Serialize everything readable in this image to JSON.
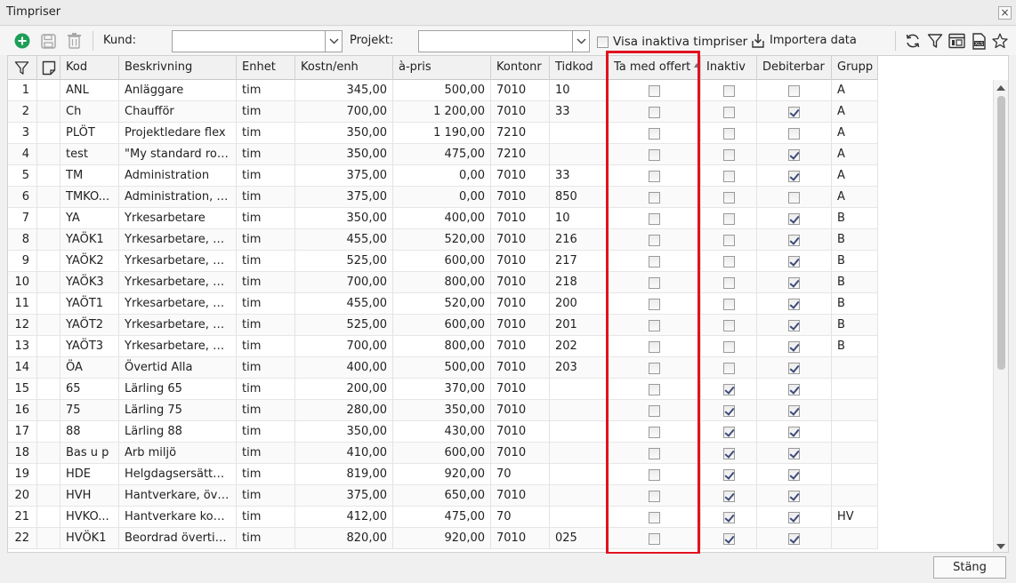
{
  "window": {
    "title": "Timpriser"
  },
  "toolbar": {
    "kund_label": "Kund:",
    "kund_value": "",
    "projekt_label": "Projekt:",
    "projekt_value": "",
    "show_inactive_label": "Visa inaktiva timpriser",
    "show_inactive_checked": false,
    "import_label": "Importera data"
  },
  "columns": [
    {
      "key": "filter",
      "label": ""
    },
    {
      "key": "note",
      "label": ""
    },
    {
      "key": "kod",
      "label": "Kod"
    },
    {
      "key": "beskrivning",
      "label": "Beskrivning"
    },
    {
      "key": "enhet",
      "label": "Enhet"
    },
    {
      "key": "kostn",
      "label": "Kostn/enh"
    },
    {
      "key": "apris",
      "label": "à-pris"
    },
    {
      "key": "kontonr",
      "label": "Kontonr"
    },
    {
      "key": "tidkod",
      "label": "Tidkod"
    },
    {
      "key": "tamed",
      "label": "Ta med offert",
      "sorted": "asc"
    },
    {
      "key": "inaktiv",
      "label": "Inaktiv"
    },
    {
      "key": "debiterbar",
      "label": "Debiterbar"
    },
    {
      "key": "grupp",
      "label": "Grupp"
    }
  ],
  "rows": [
    {
      "n": "1",
      "kod": "ANL",
      "beskrivning": "Anläggare",
      "enhet": "tim",
      "kostn": "345,00",
      "apris": "500,00",
      "kontonr": "7010",
      "tidkod": "10",
      "tamed": false,
      "inaktiv": false,
      "debiterbar": false,
      "grupp": "A"
    },
    {
      "n": "2",
      "kod": "Ch",
      "beskrivning": "Chaufför",
      "enhet": "tim",
      "kostn": "700,00",
      "apris": "1 200,00",
      "kontonr": "7010",
      "tidkod": "33",
      "tamed": false,
      "inaktiv": false,
      "debiterbar": true,
      "grupp": "A"
    },
    {
      "n": "3",
      "kod": "PLÖT",
      "beskrivning": "Projektledare flex",
      "enhet": "tim",
      "kostn": "350,00",
      "apris": "1 190,00",
      "kontonr": "7210",
      "tidkod": "",
      "tamed": false,
      "inaktiv": false,
      "debiterbar": false,
      "grupp": "A"
    },
    {
      "n": "4",
      "kod": "test",
      "beskrivning": "\"My standard role\"",
      "enhet": "tim",
      "kostn": "350,00",
      "apris": "475,00",
      "kontonr": "7210",
      "tidkod": "",
      "tamed": false,
      "inaktiv": false,
      "debiterbar": true,
      "grupp": "A"
    },
    {
      "n": "5",
      "kod": "TM",
      "beskrivning": "Administration",
      "enhet": "tim",
      "kostn": "375,00",
      "apris": "0,00",
      "kontonr": "7010",
      "tidkod": "33",
      "tamed": false,
      "inaktiv": false,
      "debiterbar": true,
      "grupp": "A"
    },
    {
      "n": "6",
      "kod": "TMKO...",
      "beskrivning": "Administration, i...",
      "enhet": "tim",
      "kostn": "375,00",
      "apris": "0,00",
      "kontonr": "7010",
      "tidkod": "850",
      "tamed": false,
      "inaktiv": false,
      "debiterbar": false,
      "grupp": "A"
    },
    {
      "n": "7",
      "kod": "YA",
      "beskrivning": "Yrkesarbetare",
      "enhet": "tim",
      "kostn": "350,00",
      "apris": "400,00",
      "kontonr": "7010",
      "tidkod": "10",
      "tamed": false,
      "inaktiv": false,
      "debiterbar": true,
      "grupp": "B"
    },
    {
      "n": "8",
      "kod": "YAÖK1",
      "beskrivning": "Yrkesarbetare, öv...",
      "enhet": "tim",
      "kostn": "455,00",
      "apris": "520,00",
      "kontonr": "7010",
      "tidkod": "216",
      "tamed": false,
      "inaktiv": false,
      "debiterbar": true,
      "grupp": "B"
    },
    {
      "n": "9",
      "kod": "YAÖK2",
      "beskrivning": "Yrkesarbetare, öv...",
      "enhet": "tim",
      "kostn": "525,00",
      "apris": "600,00",
      "kontonr": "7010",
      "tidkod": "217",
      "tamed": false,
      "inaktiv": false,
      "debiterbar": true,
      "grupp": "B"
    },
    {
      "n": "10",
      "kod": "YAÖK3",
      "beskrivning": "Yrkesarbetare, öv...",
      "enhet": "tim",
      "kostn": "700,00",
      "apris": "800,00",
      "kontonr": "7010",
      "tidkod": "218",
      "tamed": false,
      "inaktiv": false,
      "debiterbar": true,
      "grupp": "B"
    },
    {
      "n": "11",
      "kod": "YAÖT1",
      "beskrivning": "Yrkesarbetare, öv...",
      "enhet": "tim",
      "kostn": "455,00",
      "apris": "520,00",
      "kontonr": "7010",
      "tidkod": "200",
      "tamed": false,
      "inaktiv": false,
      "debiterbar": true,
      "grupp": "B"
    },
    {
      "n": "12",
      "kod": "YAÖT2",
      "beskrivning": "Yrkesarbetare, öv...",
      "enhet": "tim",
      "kostn": "525,00",
      "apris": "600,00",
      "kontonr": "7010",
      "tidkod": "201",
      "tamed": false,
      "inaktiv": false,
      "debiterbar": true,
      "grupp": "B"
    },
    {
      "n": "13",
      "kod": "YAÖT3",
      "beskrivning": "Yrkesarbetare, öv...",
      "enhet": "tim",
      "kostn": "700,00",
      "apris": "800,00",
      "kontonr": "7010",
      "tidkod": "202",
      "tamed": false,
      "inaktiv": false,
      "debiterbar": true,
      "grupp": "B"
    },
    {
      "n": "14",
      "kod": "ÖA",
      "beskrivning": "Övertid Alla",
      "enhet": "tim",
      "kostn": "400,00",
      "apris": "500,00",
      "kontonr": "7010",
      "tidkod": "203",
      "tamed": false,
      "inaktiv": false,
      "debiterbar": true,
      "grupp": ""
    },
    {
      "n": "15",
      "kod": "65",
      "beskrivning": "Lärling 65",
      "enhet": "tim",
      "kostn": "200,00",
      "apris": "370,00",
      "kontonr": "7010",
      "tidkod": "",
      "tamed": false,
      "inaktiv": true,
      "debiterbar": true,
      "grupp": ""
    },
    {
      "n": "16",
      "kod": "75",
      "beskrivning": "Lärling 75",
      "enhet": "tim",
      "kostn": "280,00",
      "apris": "350,00",
      "kontonr": "7010",
      "tidkod": "",
      "tamed": false,
      "inaktiv": true,
      "debiterbar": true,
      "grupp": ""
    },
    {
      "n": "17",
      "kod": "88",
      "beskrivning": "Lärling 88",
      "enhet": "tim",
      "kostn": "350,00",
      "apris": "430,00",
      "kontonr": "7010",
      "tidkod": "",
      "tamed": false,
      "inaktiv": true,
      "debiterbar": true,
      "grupp": ""
    },
    {
      "n": "18",
      "kod": "Bas u p",
      "beskrivning": "Arb miljö",
      "enhet": "tim",
      "kostn": "410,00",
      "apris": "600,00",
      "kontonr": "7010",
      "tidkod": "",
      "tamed": false,
      "inaktiv": true,
      "debiterbar": true,
      "grupp": ""
    },
    {
      "n": "19",
      "kod": "HDE",
      "beskrivning": "Helgdagsersättni...",
      "enhet": "tim",
      "kostn": "819,00",
      "apris": "920,00",
      "kontonr": "70",
      "tidkod": "",
      "tamed": false,
      "inaktiv": true,
      "debiterbar": true,
      "grupp": ""
    },
    {
      "n": "20",
      "kod": "HVH",
      "beskrivning": "Hantverkare, öve...",
      "enhet": "tim",
      "kostn": "375,00",
      "apris": "650,00",
      "kontonr": "7010",
      "tidkod": "",
      "tamed": false,
      "inaktiv": true,
      "debiterbar": true,
      "grupp": ""
    },
    {
      "n": "21",
      "kod": "HVKO...",
      "beskrivning": "Hantverkare komp",
      "enhet": "tim",
      "kostn": "412,00",
      "apris": "475,00",
      "kontonr": "70",
      "tidkod": "",
      "tamed": false,
      "inaktiv": true,
      "debiterbar": true,
      "grupp": "HV"
    },
    {
      "n": "22",
      "kod": "HVÖK1",
      "beskrivning": "Beordrad övertid ...",
      "enhet": "tim",
      "kostn": "820,00",
      "apris": "920,00",
      "kontonr": "7010",
      "tidkod": "025",
      "tamed": false,
      "inaktiv": true,
      "debiterbar": true,
      "grupp": ""
    }
  ],
  "footer": {
    "close_label": "Stäng"
  },
  "colors": {
    "highlight": "#e0131f",
    "add_icon": "#1f9e58"
  }
}
